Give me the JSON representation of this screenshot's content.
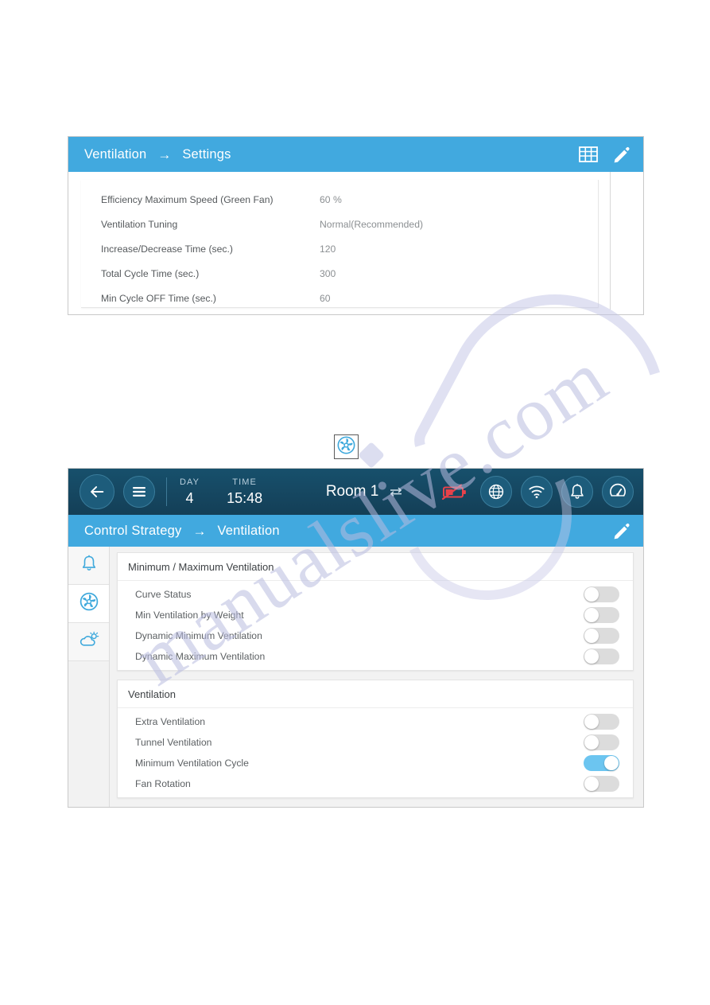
{
  "colors": {
    "header_blue": "#41a9df",
    "navbar_dark": "#164a64",
    "toggle_on": "#6cc5f0",
    "toggle_off": "#dcdcdc",
    "battery_alert_red": "#e8424a"
  },
  "panel_one": {
    "breadcrumb": {
      "parent": "Ventilation",
      "arrow": "→",
      "current": "Settings"
    },
    "actions": [
      {
        "name": "table-view-icon",
        "label": "Table"
      },
      {
        "name": "edit-pencil-icon",
        "label": "Edit"
      }
    ],
    "settings_rows": [
      {
        "label": "Efficiency Maximum Speed (Green Fan)",
        "value": "60 %"
      },
      {
        "label": "Ventilation Tuning",
        "value": "Normal(Recommended)"
      },
      {
        "label": "Increase/Decrease Time (sec.)",
        "value": "120"
      },
      {
        "label": "Total Cycle Time (sec.)",
        "value": "300"
      },
      {
        "label": "Min Cycle OFF Time (sec.)",
        "value": "60"
      }
    ]
  },
  "fan_badge": {
    "icon": "fan-icon"
  },
  "panel_two": {
    "navbar": {
      "back_label": "Back",
      "menu_label": "Menu",
      "day_label": "DAY",
      "day_value": "4",
      "time_label": "TIME",
      "time_value": "15:48",
      "room_name": "Room 1",
      "status_icons": [
        {
          "name": "battery-off-icon",
          "label": "Battery Off"
        },
        {
          "name": "globe-icon",
          "label": "Network"
        },
        {
          "name": "wifi-icon",
          "label": "Wi-Fi"
        },
        {
          "name": "bell-icon",
          "label": "Alarms"
        },
        {
          "name": "gauge-icon",
          "label": "Performance"
        }
      ]
    },
    "breadcrumb": {
      "parent": "Control Strategy",
      "arrow": "→",
      "current": "Ventilation"
    },
    "edit_action": {
      "name": "edit-pencil-icon",
      "label": "Edit"
    },
    "side_rail": [
      {
        "name": "sidebar-item-alarms",
        "icon": "bell-icon",
        "label": "Alarms",
        "active": false
      },
      {
        "name": "sidebar-item-ventilation",
        "icon": "fan-icon",
        "label": "Ventilation",
        "active": true
      },
      {
        "name": "sidebar-item-climate",
        "icon": "cloud-sun-icon",
        "label": "Climate",
        "active": false
      }
    ],
    "cards": [
      {
        "title": "Minimum / Maximum Ventilation",
        "rows": [
          {
            "label": "Curve Status",
            "on": false
          },
          {
            "label": "Min Ventilation by Weight",
            "on": false
          },
          {
            "label": "Dynamic Minimum Ventilation",
            "on": false
          },
          {
            "label": "Dynamic Maximum Ventilation",
            "on": false
          }
        ]
      },
      {
        "title": "Ventilation",
        "rows": [
          {
            "label": "Extra Ventilation",
            "on": false
          },
          {
            "label": "Tunnel Ventilation",
            "on": false
          },
          {
            "label": "Minimum Ventilation Cycle",
            "on": true
          },
          {
            "label": "Fan Rotation",
            "on": false
          }
        ]
      }
    ]
  },
  "watermark": {
    "text": "manualslive.com"
  }
}
